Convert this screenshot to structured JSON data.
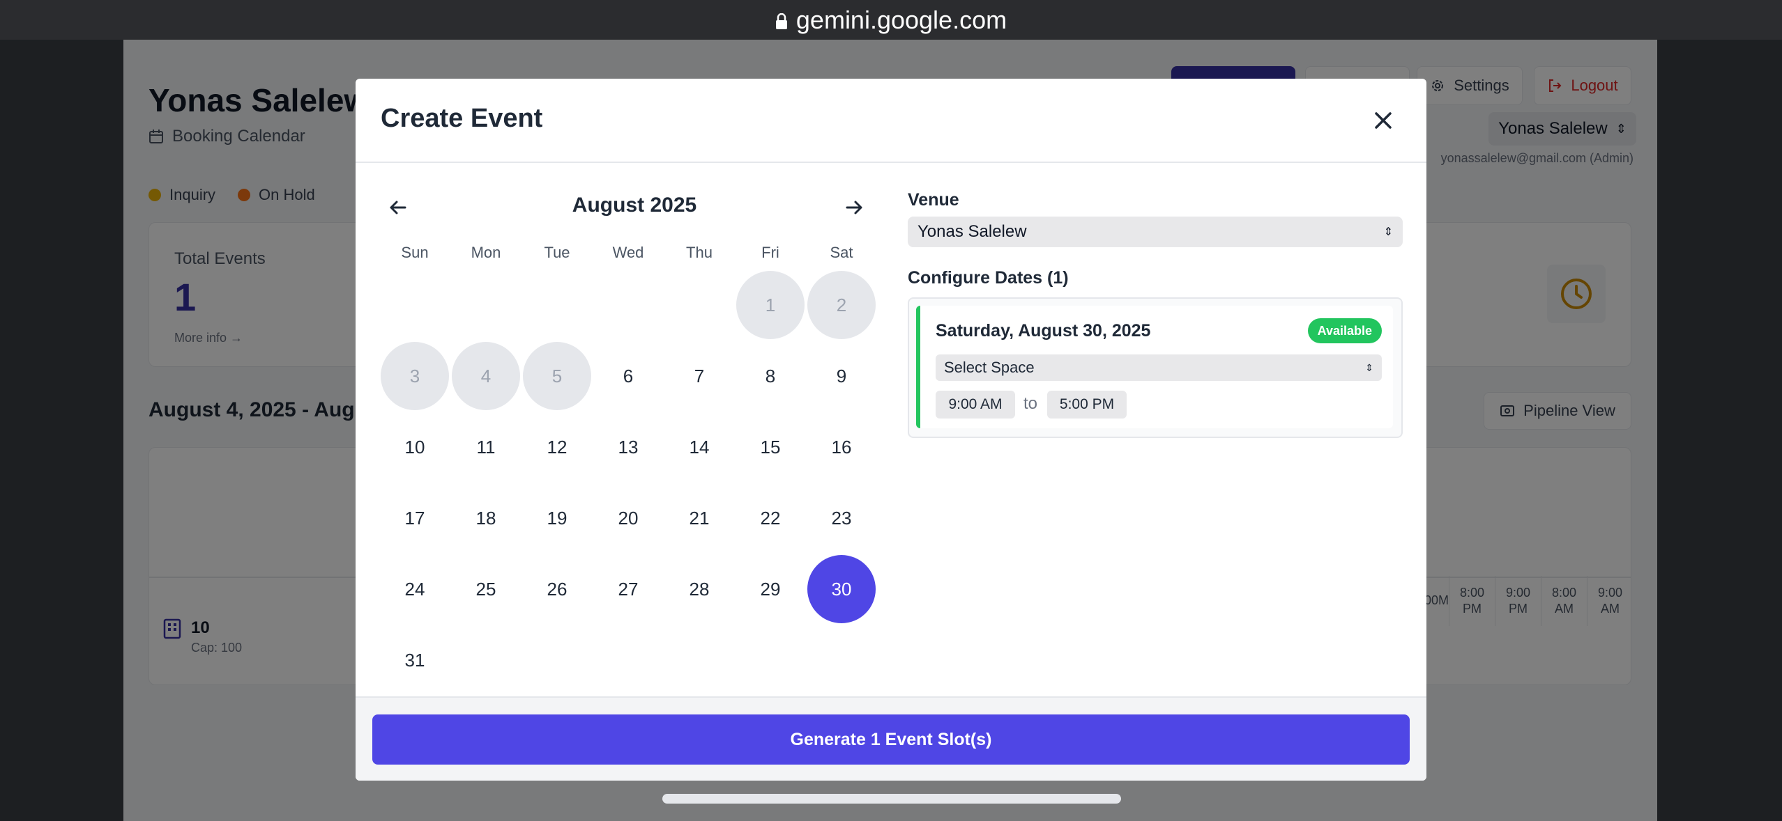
{
  "browser": {
    "url": "gemini.google.com"
  },
  "background": {
    "title": "Yonas Salelew",
    "subtitle": "Booking Calendar",
    "legend": [
      {
        "label": "Inquiry",
        "color": "#eab308"
      },
      {
        "label": "On Hold",
        "color": "#f97316"
      }
    ],
    "stats": {
      "label": "Total Events",
      "value": "1",
      "more": "More info →"
    },
    "range_title": "August 4, 2025 - Aug",
    "settings_label": "Settings",
    "logout_label": "Logout",
    "user_select": "Yonas Salelew",
    "user_email": "yonassalelew@gmail.com (Admin)",
    "pipeline_label": "Pipeline View",
    "time_columns": [
      {
        "line1": "00",
        "line2": "M"
      },
      {
        "line1": "8:00",
        "line2": "PM"
      },
      {
        "line1": "9:00",
        "line2": "PM"
      },
      {
        "line1": "8:00",
        "line2": "AM"
      },
      {
        "line1": "9:00",
        "line2": "AM"
      }
    ],
    "space": {
      "name": "10",
      "capacity": "Cap: 100"
    }
  },
  "modal": {
    "title": "Create Event",
    "calendar": {
      "month_label": "August 2025",
      "weekdays": [
        "Sun",
        "Mon",
        "Tue",
        "Wed",
        "Thu",
        "Fri",
        "Sat"
      ],
      "first_weekday_index": 5,
      "days_in_month": 31,
      "past_days": [
        1,
        2,
        3,
        4,
        5
      ],
      "selected_day": 30
    },
    "venue": {
      "label": "Venue",
      "value": "Yonas Salelew"
    },
    "configure": {
      "label": "Configure Dates (1)",
      "dates": [
        {
          "title": "Saturday, August 30, 2025",
          "badge": "Available",
          "space_placeholder": "Select Space",
          "start_time": "9:00 AM",
          "to_label": "to",
          "end_time": "5:00 PM"
        }
      ]
    },
    "generate_label": "Generate 1 Event Slot(s)"
  }
}
